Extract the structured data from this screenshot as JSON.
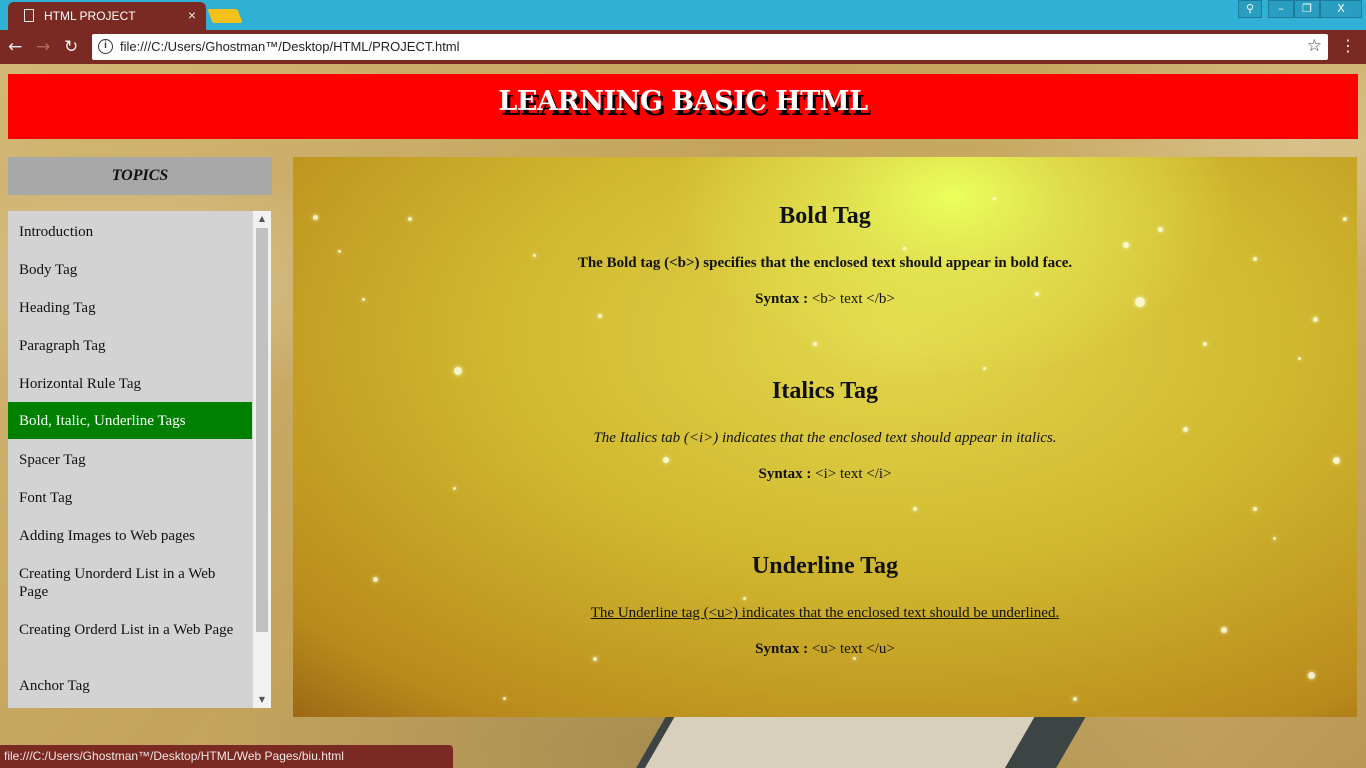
{
  "browser": {
    "tab_title": "HTML PROJECT",
    "tab_close": "×",
    "url": "file:///C:/Users/Ghostman™/Desktop/HTML/PROJECT.html",
    "status_url": "file:///C:/Users/Ghostman™/Desktop/HTML/Web Pages/biu.html",
    "win_minimize": "–",
    "win_restore": "❐",
    "win_close": "X",
    "back": "←",
    "forward": "→",
    "reload": "↻",
    "info": "i",
    "star": "☆",
    "menu": "⋮"
  },
  "header": {
    "title": "LEARNING BASIC HTML",
    "color": "#ff0000"
  },
  "sidebar": {
    "title": "TOPICS",
    "items": [
      {
        "label": "Introduction",
        "active": false
      },
      {
        "label": "Body Tag",
        "active": false
      },
      {
        "label": "Heading Tag",
        "active": false
      },
      {
        "label": "Paragraph Tag",
        "active": false
      },
      {
        "label": "Horizontal Rule Tag",
        "active": false
      },
      {
        "label": "Bold, Italic, Underline Tags",
        "active": true
      },
      {
        "label": "Spacer Tag",
        "active": false
      },
      {
        "label": "Font Tag",
        "active": false
      },
      {
        "label": "Adding Images to Web pages",
        "active": false
      },
      {
        "label": "Creating Unorderd List in a Web Page",
        "active": false
      },
      {
        "label": "Creating Orderd List in a Web Page",
        "active": false
      },
      {
        "label": "Anchor Tag",
        "active": false
      }
    ],
    "active_color": "#008000"
  },
  "main": {
    "bold": {
      "title": "Bold Tag",
      "desc": "The Bold tag (<b>) specifies that the enclosed text should appear in bold face.",
      "syntax_label": "Syntax :",
      "syntax_code": " <b> text </b>"
    },
    "italics": {
      "title": "Italics Tag",
      "desc": "The Italics tab (<i>) indicates that the enclosed text should appear in italics.",
      "syntax_label": "Syntax :",
      "syntax_code": " <i> text </i>"
    },
    "underline": {
      "title": "Underline Tag",
      "desc": "The Underline tag (<u>) indicates that the enclosed text should be underlined.",
      "syntax_label": "Syntax :",
      "syntax_code": " <u> text </u>"
    }
  }
}
